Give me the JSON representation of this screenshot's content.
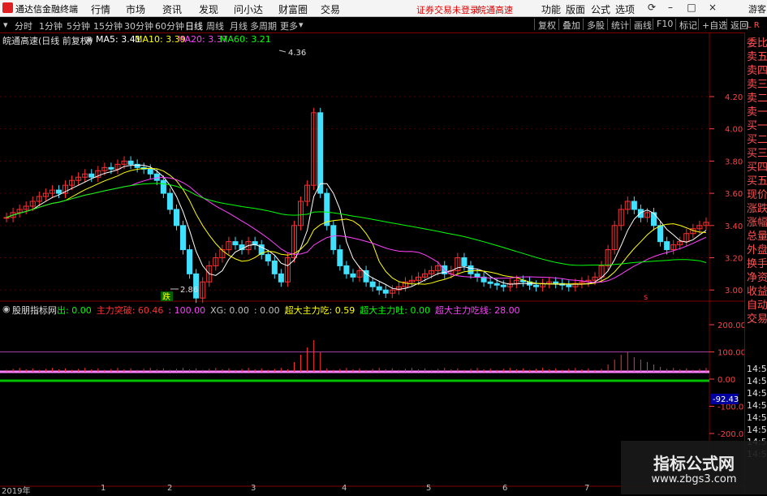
{
  "app": {
    "name": "通达信金融终端"
  },
  "menu": [
    "行情",
    "市场",
    "资讯",
    "发现",
    "问小达",
    "财富圈",
    "交易"
  ],
  "alerts": [
    "证券交易未登录",
    "皖通高速"
  ],
  "right_menu": [
    "功能",
    "版面",
    "公式",
    "选项"
  ],
  "user": "游客",
  "periods": [
    "分时",
    "1分钟",
    "5分钟",
    "15分钟",
    "30分钟",
    "60分钟",
    "日线",
    "周线",
    "月线",
    "多周期",
    "更多"
  ],
  "active_period": "日线",
  "tools": [
    "复权",
    "叠加",
    "多股",
    "统计",
    "画线",
    "F10",
    "标记",
    "+自选",
    "返回"
  ],
  "stock": {
    "title": "皖通高速(日线 前复权)"
  },
  "ma": [
    {
      "label": "MA5: 3.41",
      "color": "#ffffff"
    },
    {
      "label": "MA10: 3.39",
      "color": "#ffff00"
    },
    {
      "label": "MA20: 3.37",
      "color": "#ff40ff"
    },
    {
      "label": "MA60: 3.21",
      "color": "#00ff00"
    }
  ],
  "annotations": {
    "high": "4.36",
    "low": "2.86",
    "fall_marker": "跌",
    "s_marker": "s"
  },
  "price_axis": [
    "4.20",
    "4.00",
    "3.80",
    "3.60",
    "3.40",
    "3.20",
    "3.00"
  ],
  "indicator": {
    "name": "股朋指标网",
    "items": [
      {
        "label": "出: 0.00",
        "color": "#00ff00"
      },
      {
        "label": "主力突破: 60.46",
        "color": "#ff3030"
      },
      {
        "label": ": 100.00",
        "color": "#ff40ff"
      },
      {
        "label": "XG: 0.00",
        "color": "#c0c0c0"
      },
      {
        "label": ": 0.00",
        "color": "#c0c0c0"
      },
      {
        "label": "超大主力吃: 0.59",
        "color": "#ffff00"
      },
      {
        "label": "超大主力吐: 0.00",
        "color": "#00ff00"
      },
      {
        "label": "超大主力吃线: 28.00",
        "color": "#ff40ff"
      }
    ],
    "axis": [
      "200.00",
      "100.00",
      "0.00",
      "-100.00",
      "-200.00"
    ],
    "current": "-92.43"
  },
  "right_panel": [
    "委比",
    "卖五",
    "卖四",
    "卖三",
    "卖二",
    "卖一",
    "买一",
    "买二",
    "买三",
    "买四",
    "买五",
    "现价",
    "涨跌",
    "涨幅",
    "总量",
    "外盘",
    "换手",
    "净资",
    "收益",
    "自动",
    "交易"
  ],
  "right_panel_times": [
    "14:56",
    "14:56",
    "14:56",
    "14:56",
    "14:56",
    "14:56",
    "14:56",
    "14:56"
  ],
  "right_panel_header": "L R",
  "x_axis": [
    "2019年",
    "1",
    "2",
    "3",
    "4",
    "5",
    "6",
    "7"
  ],
  "watermark": {
    "title": "指标公式网",
    "url": "www.zbgs3.com"
  },
  "colors": {
    "up": "#ff3030",
    "down": "#40e0ff",
    "grid": "#800000"
  }
}
